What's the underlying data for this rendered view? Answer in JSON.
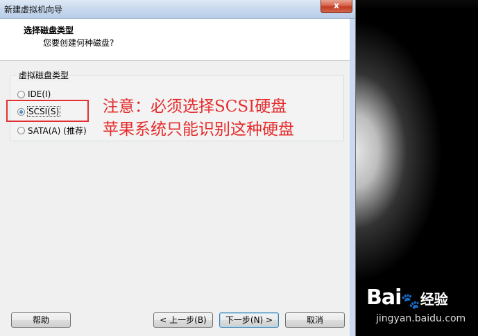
{
  "window": {
    "title": "新建虚拟机向导",
    "close_label": "x"
  },
  "header": {
    "heading": "选择磁盘类型",
    "subheading": "您要创建何种磁盘?"
  },
  "disk_type_group": {
    "legend": "虚拟磁盘类型",
    "options": [
      {
        "label": "IDE(I)",
        "checked": false
      },
      {
        "label": "SCSI(S)",
        "checked": true
      },
      {
        "label": "SATA(A)",
        "checked": false,
        "note": "(推荐)"
      }
    ]
  },
  "annotation": {
    "line1": "注意：必须选择SCSI硬盘",
    "line2": "苹果系统只能识别这种硬盘",
    "color": "#e52b2b"
  },
  "buttons": {
    "help": "帮助",
    "back": "< 上一步(B)",
    "next": "下一步(N) >",
    "cancel": "取消"
  },
  "watermark": {
    "logo": "Bai",
    "paw": "🐾",
    "suffix": "经验",
    "url": "jingyan.baidu.com"
  }
}
